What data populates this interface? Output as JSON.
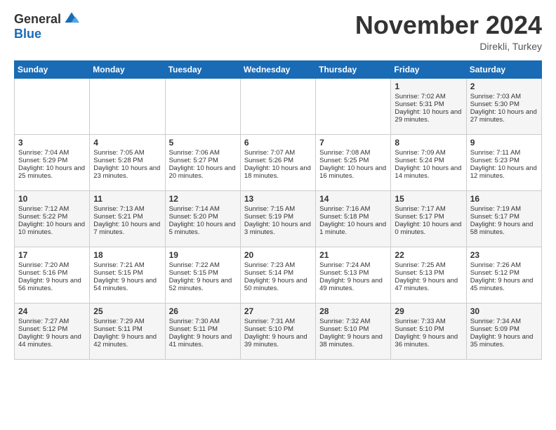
{
  "logo": {
    "general": "General",
    "blue": "Blue"
  },
  "title": "November 2024",
  "location": "Direkli, Turkey",
  "days_of_week": [
    "Sunday",
    "Monday",
    "Tuesday",
    "Wednesday",
    "Thursday",
    "Friday",
    "Saturday"
  ],
  "weeks": [
    [
      {
        "day": "",
        "info": ""
      },
      {
        "day": "",
        "info": ""
      },
      {
        "day": "",
        "info": ""
      },
      {
        "day": "",
        "info": ""
      },
      {
        "day": "",
        "info": ""
      },
      {
        "day": "1",
        "info": "Sunrise: 7:02 AM\nSunset: 5:31 PM\nDaylight: 10 hours and 29 minutes."
      },
      {
        "day": "2",
        "info": "Sunrise: 7:03 AM\nSunset: 5:30 PM\nDaylight: 10 hours and 27 minutes."
      }
    ],
    [
      {
        "day": "3",
        "info": "Sunrise: 7:04 AM\nSunset: 5:29 PM\nDaylight: 10 hours and 25 minutes."
      },
      {
        "day": "4",
        "info": "Sunrise: 7:05 AM\nSunset: 5:28 PM\nDaylight: 10 hours and 23 minutes."
      },
      {
        "day": "5",
        "info": "Sunrise: 7:06 AM\nSunset: 5:27 PM\nDaylight: 10 hours and 20 minutes."
      },
      {
        "day": "6",
        "info": "Sunrise: 7:07 AM\nSunset: 5:26 PM\nDaylight: 10 hours and 18 minutes."
      },
      {
        "day": "7",
        "info": "Sunrise: 7:08 AM\nSunset: 5:25 PM\nDaylight: 10 hours and 16 minutes."
      },
      {
        "day": "8",
        "info": "Sunrise: 7:09 AM\nSunset: 5:24 PM\nDaylight: 10 hours and 14 minutes."
      },
      {
        "day": "9",
        "info": "Sunrise: 7:11 AM\nSunset: 5:23 PM\nDaylight: 10 hours and 12 minutes."
      }
    ],
    [
      {
        "day": "10",
        "info": "Sunrise: 7:12 AM\nSunset: 5:22 PM\nDaylight: 10 hours and 10 minutes."
      },
      {
        "day": "11",
        "info": "Sunrise: 7:13 AM\nSunset: 5:21 PM\nDaylight: 10 hours and 7 minutes."
      },
      {
        "day": "12",
        "info": "Sunrise: 7:14 AM\nSunset: 5:20 PM\nDaylight: 10 hours and 5 minutes."
      },
      {
        "day": "13",
        "info": "Sunrise: 7:15 AM\nSunset: 5:19 PM\nDaylight: 10 hours and 3 minutes."
      },
      {
        "day": "14",
        "info": "Sunrise: 7:16 AM\nSunset: 5:18 PM\nDaylight: 10 hours and 1 minute."
      },
      {
        "day": "15",
        "info": "Sunrise: 7:17 AM\nSunset: 5:17 PM\nDaylight: 10 hours and 0 minutes."
      },
      {
        "day": "16",
        "info": "Sunrise: 7:19 AM\nSunset: 5:17 PM\nDaylight: 9 hours and 58 minutes."
      }
    ],
    [
      {
        "day": "17",
        "info": "Sunrise: 7:20 AM\nSunset: 5:16 PM\nDaylight: 9 hours and 56 minutes."
      },
      {
        "day": "18",
        "info": "Sunrise: 7:21 AM\nSunset: 5:15 PM\nDaylight: 9 hours and 54 minutes."
      },
      {
        "day": "19",
        "info": "Sunrise: 7:22 AM\nSunset: 5:15 PM\nDaylight: 9 hours and 52 minutes."
      },
      {
        "day": "20",
        "info": "Sunrise: 7:23 AM\nSunset: 5:14 PM\nDaylight: 9 hours and 50 minutes."
      },
      {
        "day": "21",
        "info": "Sunrise: 7:24 AM\nSunset: 5:13 PM\nDaylight: 9 hours and 49 minutes."
      },
      {
        "day": "22",
        "info": "Sunrise: 7:25 AM\nSunset: 5:13 PM\nDaylight: 9 hours and 47 minutes."
      },
      {
        "day": "23",
        "info": "Sunrise: 7:26 AM\nSunset: 5:12 PM\nDaylight: 9 hours and 45 minutes."
      }
    ],
    [
      {
        "day": "24",
        "info": "Sunrise: 7:27 AM\nSunset: 5:12 PM\nDaylight: 9 hours and 44 minutes."
      },
      {
        "day": "25",
        "info": "Sunrise: 7:29 AM\nSunset: 5:11 PM\nDaylight: 9 hours and 42 minutes."
      },
      {
        "day": "26",
        "info": "Sunrise: 7:30 AM\nSunset: 5:11 PM\nDaylight: 9 hours and 41 minutes."
      },
      {
        "day": "27",
        "info": "Sunrise: 7:31 AM\nSunset: 5:10 PM\nDaylight: 9 hours and 39 minutes."
      },
      {
        "day": "28",
        "info": "Sunrise: 7:32 AM\nSunset: 5:10 PM\nDaylight: 9 hours and 38 minutes."
      },
      {
        "day": "29",
        "info": "Sunrise: 7:33 AM\nSunset: 5:10 PM\nDaylight: 9 hours and 36 minutes."
      },
      {
        "day": "30",
        "info": "Sunrise: 7:34 AM\nSunset: 5:09 PM\nDaylight: 9 hours and 35 minutes."
      }
    ]
  ]
}
